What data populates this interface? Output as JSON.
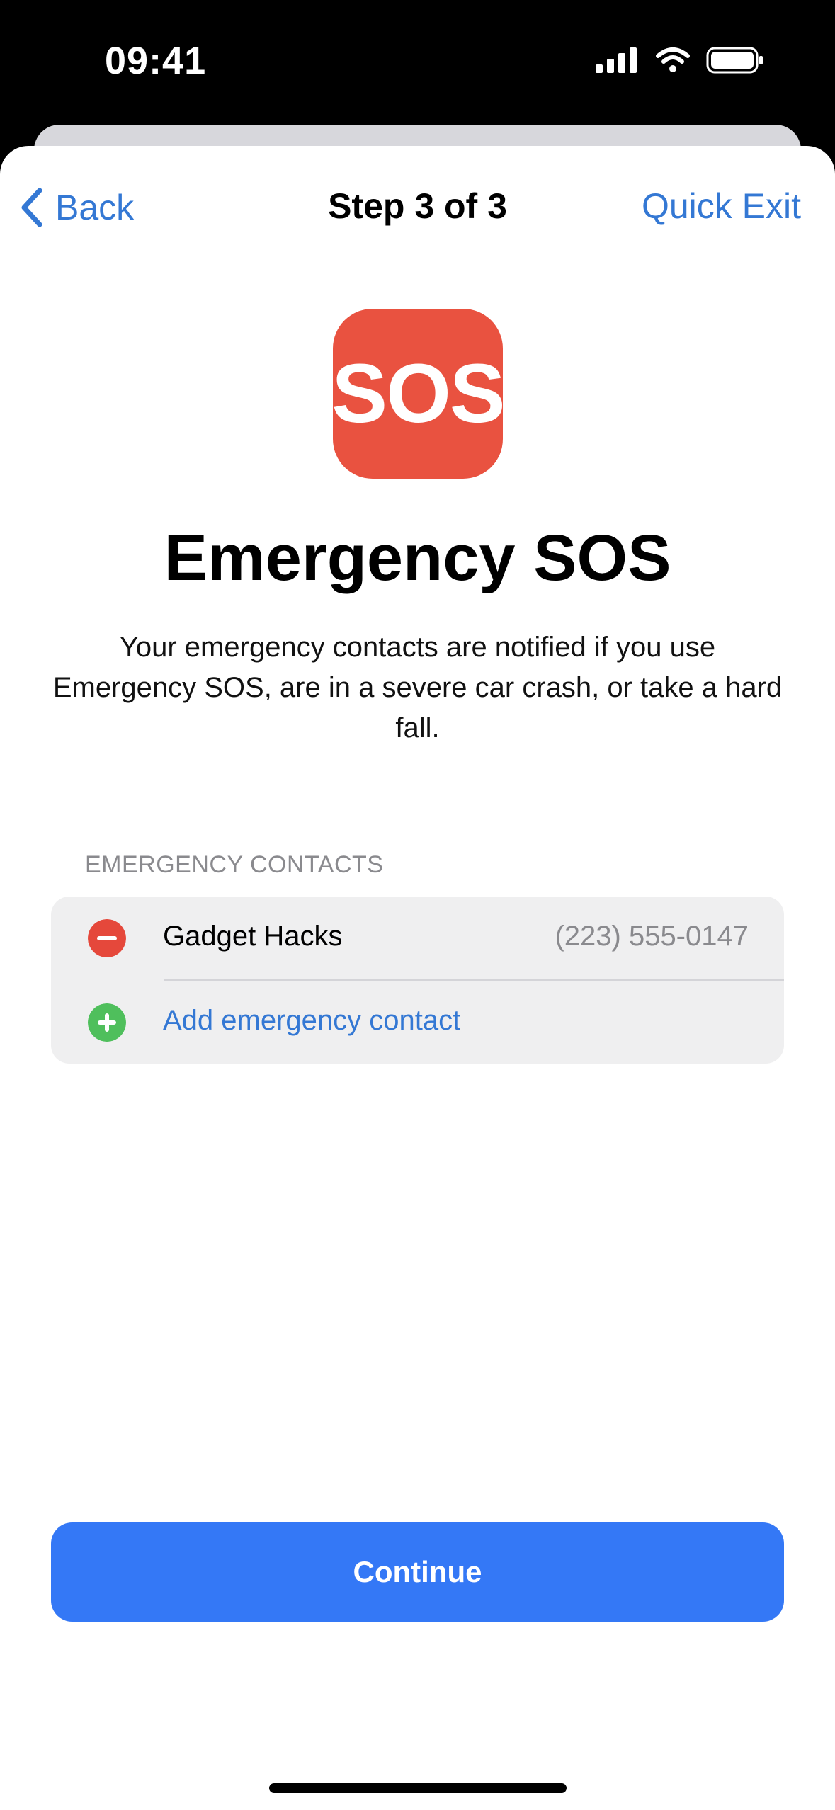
{
  "status_bar": {
    "time": "09:41",
    "icons": [
      "cellular-signal-icon",
      "wifi-icon",
      "battery-icon"
    ]
  },
  "nav": {
    "back_label": "Back",
    "title": "Step 3 of 3",
    "quick_exit_label": "Quick Exit"
  },
  "app_icon": {
    "text": "SOS",
    "color": "#e95240"
  },
  "main": {
    "title": "Emergency SOS",
    "description": "Your emergency contacts are notified if you use Emergency SOS, are in a severe car crash, or take a hard fall."
  },
  "contacts": {
    "section_header": "EMERGENCY CONTACTS",
    "items": [
      {
        "name": "Gadget Hacks",
        "phone": "(223) 555-0147",
        "icon": "remove-icon"
      }
    ],
    "add_label": "Add emergency contact",
    "add_icon": "add-icon"
  },
  "footer": {
    "continue_label": "Continue"
  },
  "colors": {
    "accent": "#3478d4",
    "button": "#3478f6",
    "remove": "#e5483b",
    "add": "#4fbf5c"
  }
}
